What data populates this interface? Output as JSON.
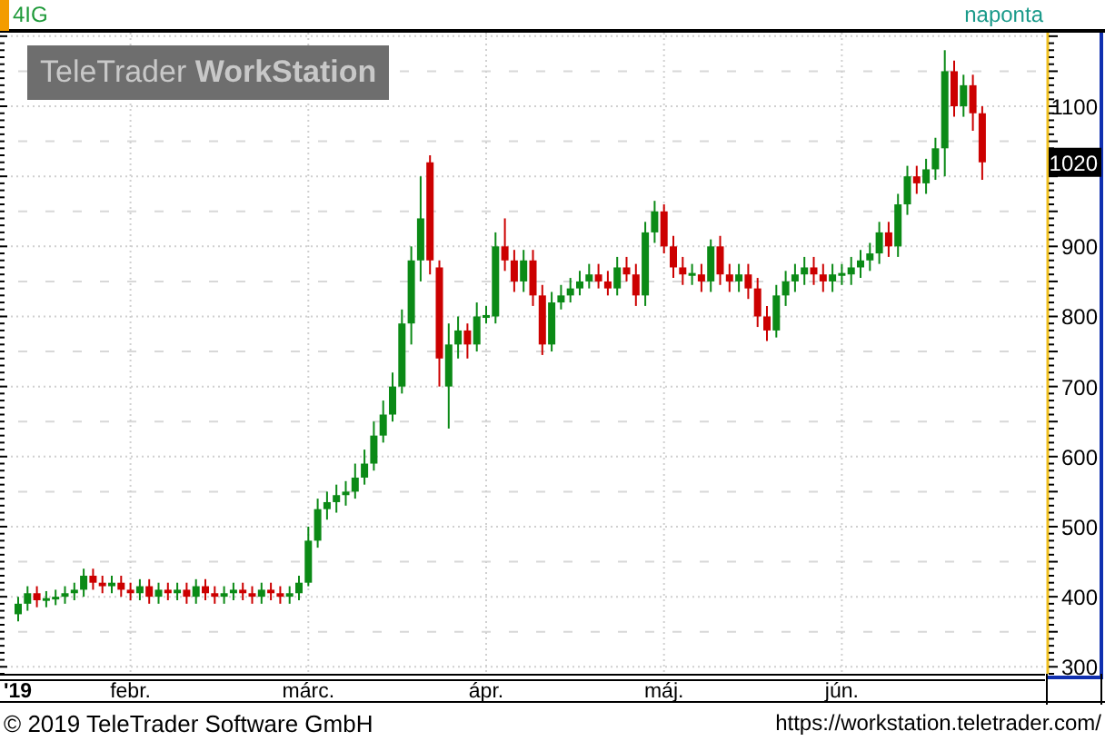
{
  "header": {
    "symbol": "4IG",
    "interval": "naponta"
  },
  "logo": "TeleTrader **WorkStation**",
  "chart": {
    "last_price": "1020",
    "month_labels": [
      "'19",
      "febr.",
      "márc.",
      "ápr.",
      "máj.",
      "jún."
    ],
    "chart_data": {
      "type": "candlestick",
      "grid": true,
      "ylim": [
        290,
        1205
      ],
      "yticks": [
        1100,
        900,
        800,
        700,
        600,
        500,
        400,
        300
      ],
      "ohlc": [
        [
          375,
          400,
          365,
          390
        ],
        [
          390,
          415,
          380,
          405
        ],
        [
          405,
          415,
          385,
          395
        ],
        [
          395,
          408,
          385,
          398
        ],
        [
          398,
          410,
          388,
          400
        ],
        [
          400,
          415,
          390,
          405
        ],
        [
          405,
          420,
          395,
          410
        ],
        [
          410,
          440,
          400,
          430
        ],
        [
          430,
          440,
          410,
          420
        ],
        [
          420,
          430,
          405,
          415
        ],
        [
          415,
          430,
          405,
          420
        ],
        [
          420,
          430,
          400,
          410
        ],
        [
          410,
          420,
          395,
          405
        ],
        [
          405,
          425,
          395,
          415
        ],
        [
          415,
          425,
          390,
          400
        ],
        [
          400,
          420,
          390,
          410
        ],
        [
          410,
          420,
          395,
          405
        ],
        [
          405,
          420,
          395,
          410
        ],
        [
          410,
          420,
          390,
          400
        ],
        [
          400,
          425,
          390,
          415
        ],
        [
          415,
          425,
          395,
          405
        ],
        [
          405,
          415,
          390,
          400
        ],
        [
          400,
          415,
          390,
          405
        ],
        [
          405,
          420,
          395,
          410
        ],
        [
          410,
          420,
          395,
          405
        ],
        [
          405,
          415,
          390,
          400
        ],
        [
          400,
          420,
          390,
          410
        ],
        [
          410,
          420,
          395,
          405
        ],
        [
          405,
          415,
          390,
          400
        ],
        [
          400,
          415,
          390,
          405
        ],
        [
          405,
          430,
          395,
          420
        ],
        [
          420,
          500,
          415,
          480
        ],
        [
          480,
          540,
          470,
          525
        ],
        [
          525,
          550,
          510,
          535
        ],
        [
          535,
          560,
          520,
          545
        ],
        [
          545,
          565,
          530,
          550
        ],
        [
          550,
          590,
          540,
          570
        ],
        [
          570,
          610,
          560,
          590
        ],
        [
          590,
          650,
          580,
          630
        ],
        [
          630,
          680,
          620,
          660
        ],
        [
          660,
          720,
          650,
          700
        ],
        [
          700,
          810,
          690,
          790
        ],
        [
          790,
          900,
          760,
          880
        ],
        [
          880,
          1000,
          850,
          940
        ],
        [
          1020,
          1030,
          860,
          880
        ],
        [
          870,
          880,
          700,
          740
        ],
        [
          700,
          790,
          640,
          760
        ],
        [
          760,
          800,
          740,
          780
        ],
        [
          780,
          790,
          740,
          760
        ],
        [
          760,
          820,
          750,
          800
        ],
        [
          798,
          815,
          790,
          802
        ],
        [
          800,
          920,
          790,
          900
        ],
        [
          900,
          940,
          865,
          880
        ],
        [
          880,
          895,
          835,
          850
        ],
        [
          850,
          895,
          835,
          880
        ],
        [
          880,
          895,
          815,
          830
        ],
        [
          830,
          845,
          745,
          760
        ],
        [
          760,
          835,
          750,
          820
        ],
        [
          820,
          845,
          810,
          830
        ],
        [
          830,
          855,
          820,
          840
        ],
        [
          840,
          865,
          830,
          850
        ],
        [
          850,
          875,
          840,
          860
        ],
        [
          860,
          875,
          840,
          850
        ],
        [
          850,
          865,
          830,
          840
        ],
        [
          840,
          885,
          830,
          870
        ],
        [
          870,
          885,
          850,
          860
        ],
        [
          860,
          875,
          815,
          830
        ],
        [
          830,
          935,
          815,
          920
        ],
        [
          920,
          965,
          905,
          950
        ],
        [
          950,
          960,
          890,
          900
        ],
        [
          900,
          915,
          855,
          870
        ],
        [
          870,
          885,
          845,
          860
        ],
        [
          858,
          875,
          845,
          862
        ],
        [
          860,
          875,
          835,
          850
        ],
        [
          850,
          910,
          835,
          900
        ],
        [
          900,
          915,
          845,
          860
        ],
        [
          860,
          875,
          835,
          850
        ],
        [
          850,
          875,
          835,
          860
        ],
        [
          860,
          875,
          825,
          840
        ],
        [
          840,
          855,
          785,
          800
        ],
        [
          800,
          815,
          765,
          780
        ],
        [
          780,
          845,
          770,
          830
        ],
        [
          830,
          865,
          815,
          850
        ],
        [
          850,
          875,
          835,
          860
        ],
        [
          860,
          885,
          845,
          870
        ],
        [
          870,
          885,
          845,
          860
        ],
        [
          860,
          875,
          835,
          850
        ],
        [
          850,
          875,
          835,
          860
        ],
        [
          858,
          875,
          845,
          862
        ],
        [
          860,
          885,
          845,
          870
        ],
        [
          870,
          895,
          855,
          880
        ],
        [
          880,
          905,
          865,
          890
        ],
        [
          890,
          935,
          875,
          920
        ],
        [
          920,
          935,
          885,
          900
        ],
        [
          900,
          975,
          885,
          960
        ],
        [
          960,
          1015,
          945,
          1000
        ],
        [
          1000,
          1015,
          975,
          990
        ],
        [
          990,
          1025,
          975,
          1010
        ],
        [
          1010,
          1055,
          995,
          1040
        ],
        [
          1040,
          1180,
          1000,
          1150
        ],
        [
          1150,
          1165,
          1085,
          1100
        ],
        [
          1100,
          1145,
          1085,
          1130
        ],
        [
          1130,
          1145,
          1065,
          1090
        ],
        [
          1090,
          1100,
          995,
          1020
        ]
      ]
    }
  },
  "footer": {
    "copyright": "© 2019 TeleTrader Software GmbH",
    "url": "https://workstation.teletrader.com/"
  }
}
